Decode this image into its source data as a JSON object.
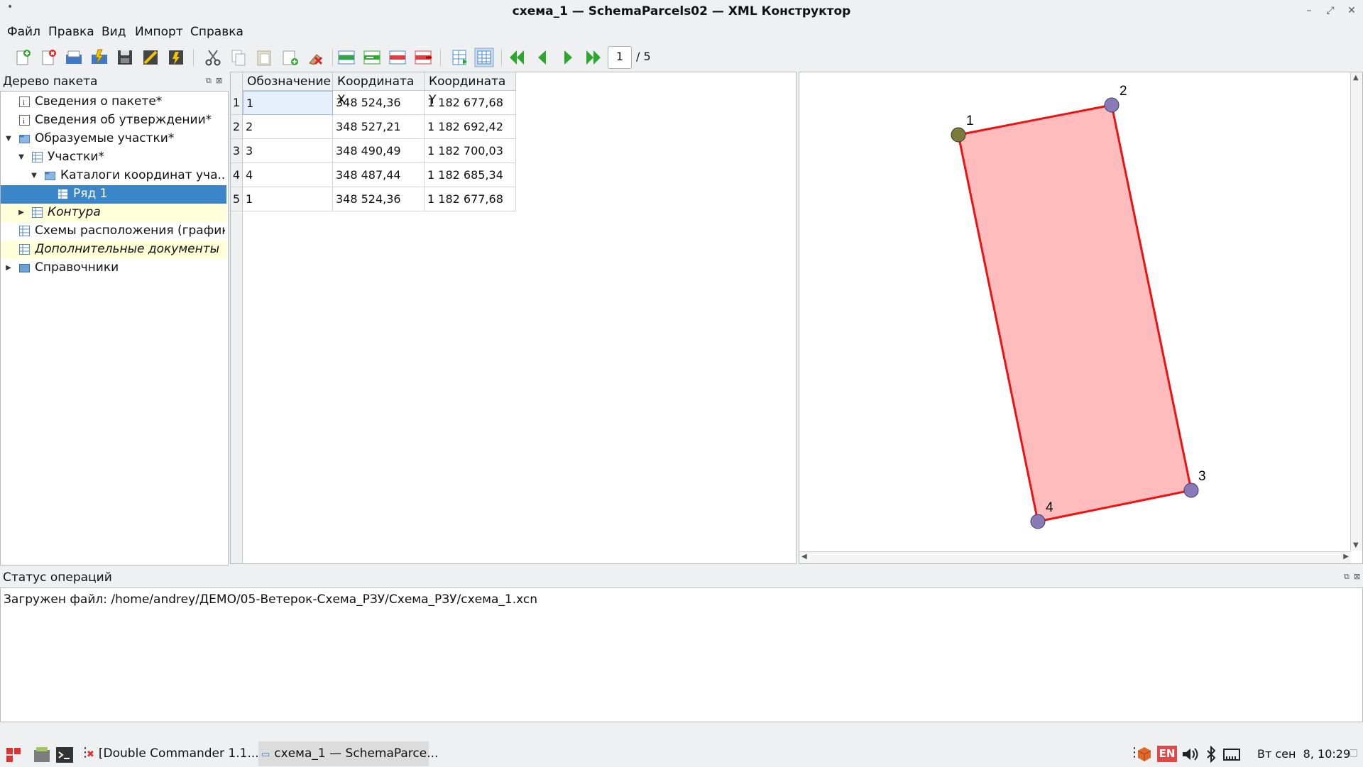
{
  "window": {
    "title": "схема_1 — SchemaParcels02 — XML Конструктор",
    "sysmenu_glyph": "•",
    "minimize": "–",
    "maximize": "⤢",
    "close": "✕"
  },
  "menu": [
    "Файл",
    "Правка",
    "Вид",
    "Импорт",
    "Справка"
  ],
  "toolbar": {
    "page_current": "1",
    "page_total": "/ 5"
  },
  "tree_panel": {
    "title": "Дерево пакета",
    "items": [
      {
        "label": "Сведения о пакете*",
        "depth": 0,
        "icon": "info-icon"
      },
      {
        "label": "Сведения об утверждении*",
        "depth": 0,
        "icon": "info-icon"
      },
      {
        "label": "Образуемые участки*",
        "depth": 0,
        "icon": "folder-open-icon",
        "expanded": true
      },
      {
        "label": "Участки*",
        "depth": 1,
        "icon": "table-icon",
        "expanded": true
      },
      {
        "label": "Каталоги координат уча...",
        "depth": 2,
        "icon": "folder-open-icon",
        "expanded": true
      },
      {
        "label": "Ряд 1",
        "depth": 3,
        "icon": "table-icon",
        "selected": true
      },
      {
        "label": "Контура",
        "depth": 1,
        "icon": "table-icon",
        "collapsed": true,
        "italic": true
      },
      {
        "label": "Схемы расположения (график...",
        "depth": 0,
        "icon": "table-icon"
      },
      {
        "label": "Дополнительные документы",
        "depth": 0,
        "icon": "table-icon",
        "italic": true
      },
      {
        "label": "Справочники",
        "depth": 0,
        "icon": "folder-icon",
        "collapsed": true
      }
    ]
  },
  "table": {
    "columns": [
      "Обозначение",
      "Координата X",
      "Координата Y"
    ],
    "rows": [
      {
        "n": "1",
        "name": "1",
        "x": "348 524,36",
        "y": "1 182 677,68"
      },
      {
        "n": "2",
        "name": "2",
        "x": "348 527,21",
        "y": "1 182 692,42"
      },
      {
        "n": "3",
        "name": "3",
        "x": "348 490,49",
        "y": "1 182 700,03"
      },
      {
        "n": "4",
        "name": "4",
        "x": "348 487,44",
        "y": "1 182 685,34"
      },
      {
        "n": "5",
        "name": "1",
        "x": "348 524,36",
        "y": "1 182 677,68"
      }
    ]
  },
  "drawing": {
    "fill_color": "#ffbcbc",
    "stroke_color": "#ee1111",
    "first_point_color": "#7a7a3a",
    "point_color": "#8a7ab8",
    "point_labels": [
      "1",
      "2",
      "3",
      "4"
    ]
  },
  "status": {
    "title": "Статус операций",
    "message": "Загружен файл: /home/andrey/ДЕМО/05-Ветерок-Схема_РЗУ/Схема_РЗУ/схема_1.xcn"
  },
  "taskbar": {
    "tasks": [
      "[Double Commander 1.1....",
      "схема_1 — SchemaParce..."
    ],
    "lang": "EN",
    "clock": "Вт сен  8, 10:29"
  }
}
